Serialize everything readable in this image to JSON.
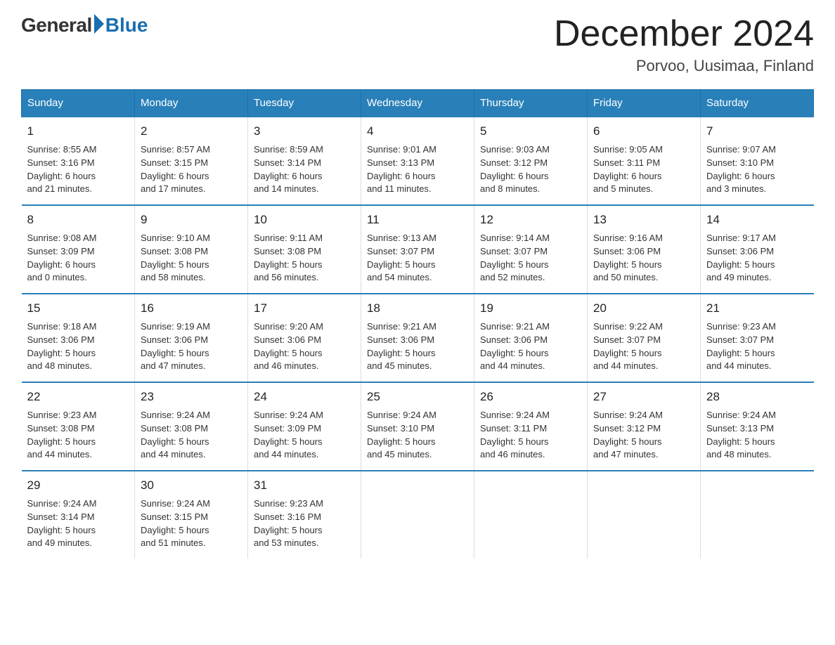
{
  "logo": {
    "general": "General",
    "blue": "Blue"
  },
  "header": {
    "month": "December 2024",
    "location": "Porvoo, Uusimaa, Finland"
  },
  "days_of_week": [
    "Sunday",
    "Monday",
    "Tuesday",
    "Wednesday",
    "Thursday",
    "Friday",
    "Saturday"
  ],
  "weeks": [
    [
      {
        "num": "1",
        "info": "Sunrise: 8:55 AM\nSunset: 3:16 PM\nDaylight: 6 hours\nand 21 minutes."
      },
      {
        "num": "2",
        "info": "Sunrise: 8:57 AM\nSunset: 3:15 PM\nDaylight: 6 hours\nand 17 minutes."
      },
      {
        "num": "3",
        "info": "Sunrise: 8:59 AM\nSunset: 3:14 PM\nDaylight: 6 hours\nand 14 minutes."
      },
      {
        "num": "4",
        "info": "Sunrise: 9:01 AM\nSunset: 3:13 PM\nDaylight: 6 hours\nand 11 minutes."
      },
      {
        "num": "5",
        "info": "Sunrise: 9:03 AM\nSunset: 3:12 PM\nDaylight: 6 hours\nand 8 minutes."
      },
      {
        "num": "6",
        "info": "Sunrise: 9:05 AM\nSunset: 3:11 PM\nDaylight: 6 hours\nand 5 minutes."
      },
      {
        "num": "7",
        "info": "Sunrise: 9:07 AM\nSunset: 3:10 PM\nDaylight: 6 hours\nand 3 minutes."
      }
    ],
    [
      {
        "num": "8",
        "info": "Sunrise: 9:08 AM\nSunset: 3:09 PM\nDaylight: 6 hours\nand 0 minutes."
      },
      {
        "num": "9",
        "info": "Sunrise: 9:10 AM\nSunset: 3:08 PM\nDaylight: 5 hours\nand 58 minutes."
      },
      {
        "num": "10",
        "info": "Sunrise: 9:11 AM\nSunset: 3:08 PM\nDaylight: 5 hours\nand 56 minutes."
      },
      {
        "num": "11",
        "info": "Sunrise: 9:13 AM\nSunset: 3:07 PM\nDaylight: 5 hours\nand 54 minutes."
      },
      {
        "num": "12",
        "info": "Sunrise: 9:14 AM\nSunset: 3:07 PM\nDaylight: 5 hours\nand 52 minutes."
      },
      {
        "num": "13",
        "info": "Sunrise: 9:16 AM\nSunset: 3:06 PM\nDaylight: 5 hours\nand 50 minutes."
      },
      {
        "num": "14",
        "info": "Sunrise: 9:17 AM\nSunset: 3:06 PM\nDaylight: 5 hours\nand 49 minutes."
      }
    ],
    [
      {
        "num": "15",
        "info": "Sunrise: 9:18 AM\nSunset: 3:06 PM\nDaylight: 5 hours\nand 48 minutes."
      },
      {
        "num": "16",
        "info": "Sunrise: 9:19 AM\nSunset: 3:06 PM\nDaylight: 5 hours\nand 47 minutes."
      },
      {
        "num": "17",
        "info": "Sunrise: 9:20 AM\nSunset: 3:06 PM\nDaylight: 5 hours\nand 46 minutes."
      },
      {
        "num": "18",
        "info": "Sunrise: 9:21 AM\nSunset: 3:06 PM\nDaylight: 5 hours\nand 45 minutes."
      },
      {
        "num": "19",
        "info": "Sunrise: 9:21 AM\nSunset: 3:06 PM\nDaylight: 5 hours\nand 44 minutes."
      },
      {
        "num": "20",
        "info": "Sunrise: 9:22 AM\nSunset: 3:07 PM\nDaylight: 5 hours\nand 44 minutes."
      },
      {
        "num": "21",
        "info": "Sunrise: 9:23 AM\nSunset: 3:07 PM\nDaylight: 5 hours\nand 44 minutes."
      }
    ],
    [
      {
        "num": "22",
        "info": "Sunrise: 9:23 AM\nSunset: 3:08 PM\nDaylight: 5 hours\nand 44 minutes."
      },
      {
        "num": "23",
        "info": "Sunrise: 9:24 AM\nSunset: 3:08 PM\nDaylight: 5 hours\nand 44 minutes."
      },
      {
        "num": "24",
        "info": "Sunrise: 9:24 AM\nSunset: 3:09 PM\nDaylight: 5 hours\nand 44 minutes."
      },
      {
        "num": "25",
        "info": "Sunrise: 9:24 AM\nSunset: 3:10 PM\nDaylight: 5 hours\nand 45 minutes."
      },
      {
        "num": "26",
        "info": "Sunrise: 9:24 AM\nSunset: 3:11 PM\nDaylight: 5 hours\nand 46 minutes."
      },
      {
        "num": "27",
        "info": "Sunrise: 9:24 AM\nSunset: 3:12 PM\nDaylight: 5 hours\nand 47 minutes."
      },
      {
        "num": "28",
        "info": "Sunrise: 9:24 AM\nSunset: 3:13 PM\nDaylight: 5 hours\nand 48 minutes."
      }
    ],
    [
      {
        "num": "29",
        "info": "Sunrise: 9:24 AM\nSunset: 3:14 PM\nDaylight: 5 hours\nand 49 minutes."
      },
      {
        "num": "30",
        "info": "Sunrise: 9:24 AM\nSunset: 3:15 PM\nDaylight: 5 hours\nand 51 minutes."
      },
      {
        "num": "31",
        "info": "Sunrise: 9:23 AM\nSunset: 3:16 PM\nDaylight: 5 hours\nand 53 minutes."
      },
      {
        "num": "",
        "info": ""
      },
      {
        "num": "",
        "info": ""
      },
      {
        "num": "",
        "info": ""
      },
      {
        "num": "",
        "info": ""
      }
    ]
  ]
}
